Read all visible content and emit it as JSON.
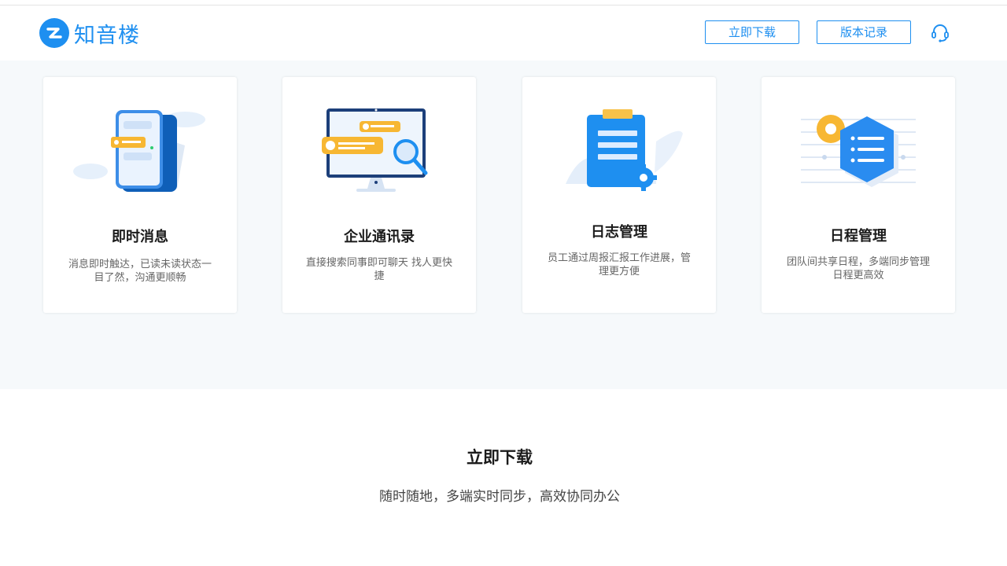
{
  "brand": {
    "name": "知音楼",
    "color": "#1e8ff0"
  },
  "header": {
    "download_label": "立即下载",
    "history_label": "版本记录",
    "support_icon": "headset-icon"
  },
  "features": [
    {
      "title": "即时消息",
      "desc": "消息即时触达，已读未读状态一目了然，沟通更顺畅",
      "icon": "chat-phone-illustration"
    },
    {
      "title": "企业通讯录",
      "desc": "直接搜索同事即可聊天 找人更快捷",
      "icon": "contacts-monitor-illustration"
    },
    {
      "title": "日志管理",
      "desc": "员工通过周报汇报工作进展，管理更方便",
      "icon": "clipboard-illustration"
    },
    {
      "title": "日程管理",
      "desc": "团队间共享日程，多端同步管理日程更高效",
      "icon": "schedule-hexagon-illustration"
    }
  ],
  "download": {
    "title": "立即下载",
    "subtitle": "随时随地，多端实时同步，高效协同办公"
  }
}
